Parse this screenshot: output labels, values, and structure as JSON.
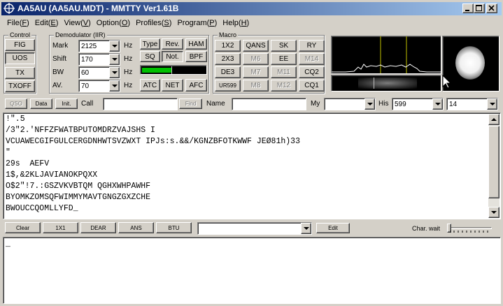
{
  "window": {
    "title": "AA5AU (AA5AU.MDT) - MMTTY Ver1.61B",
    "icon": "globe-crosshair-icon",
    "controls": [
      "minimize-icon",
      "maximize-icon",
      "close-icon"
    ]
  },
  "menu": [
    {
      "label": "File(",
      "key": "F",
      "end": ")"
    },
    {
      "label": "Edit(",
      "key": "E",
      "end": ")"
    },
    {
      "label": "View(",
      "key": "V",
      "end": ")"
    },
    {
      "label": "Option(",
      "key": "O",
      "end": ")"
    },
    {
      "label": "Profiles(",
      "key": "S",
      "end": ")"
    },
    {
      "label": "Program(",
      "key": "P",
      "end": ")"
    },
    {
      "label": "Help(",
      "key": "H",
      "end": ")"
    }
  ],
  "control": {
    "title": "Control",
    "buttons": [
      "FIG",
      "UOS",
      "TX",
      "TXOFF"
    ]
  },
  "demod": {
    "title": "Demodulator (IIR)",
    "rows": [
      {
        "label": "Mark",
        "value": "2125",
        "unit": "Hz"
      },
      {
        "label": "Shift",
        "value": "170",
        "unit": "Hz"
      },
      {
        "label": "BW",
        "value": "60",
        "unit": "Hz"
      },
      {
        "label": "AV.",
        "value": "70",
        "unit": "Hz"
      }
    ],
    "buttons": [
      "Type",
      "Rev.",
      "HAM",
      "SQ",
      "Not.",
      "BPF",
      "ATC",
      "NET",
      "AFC"
    ],
    "level": 0.47,
    "squelch": 0.47
  },
  "macro": {
    "title": "Macro",
    "buttons": [
      "1X2",
      "QANS",
      "SK",
      "RY",
      "2X3",
      "M6",
      "EE",
      "M14",
      "DE3",
      "M7",
      "M11",
      "CQ2",
      "UR599",
      "M8",
      "M12",
      "CQ1"
    ]
  },
  "qso": {
    "buttons": [
      "QSO",
      "Data",
      "Init."
    ],
    "call_label": "Call",
    "call_value": "",
    "find_label": "Find",
    "name_label": "Name",
    "name_value": "",
    "my_label": "My",
    "my_value": "",
    "his_label": "His",
    "his_value": "599",
    "extra_value": "14"
  },
  "rx_lines": [
    "!\".5",
    "/3\"2.'NFFZFWATBPUTOMDRZVAJSHS I",
    "VCUAWECGIFGULCERGDNHWTSVZWXT IPJs:s.&&/KGNZBFOTKWWF JEØ81h)33",
    "\"",
    "29s  AEFV",
    "1$,&2KLJAVIANOKPQXX",
    "O$2\"!7.:GSZVKVBTQM QGHXWHPAWHF",
    "BYOMKZOMSQFWIMMYMAVTGNGZGXZCHE",
    "BWOUCCQOMLLYFD_"
  ],
  "tx_bar": {
    "buttons": [
      "Clear",
      "1X1",
      "DEAR",
      "ANS",
      "BTU"
    ],
    "combo_value": "",
    "edit_label": "Edit",
    "charwait_label": "Char. wait",
    "charwait_value": 0.0
  },
  "tx_text": "_"
}
